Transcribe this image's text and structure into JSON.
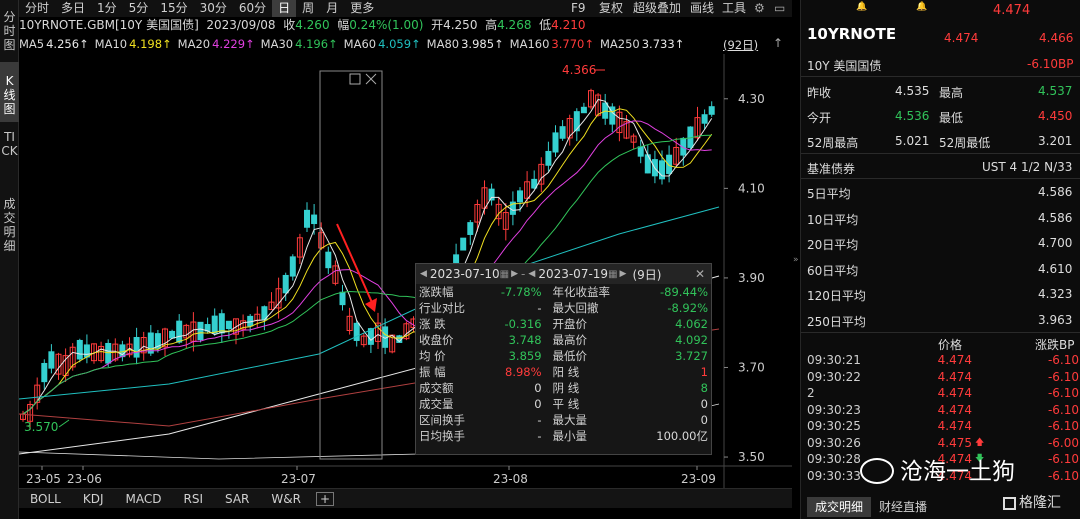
{
  "left_tabs": [
    "分时图",
    "K线图",
    "TICK",
    "成交明细"
  ],
  "toolbar": {
    "periods": [
      "分时",
      "多日",
      "1分",
      "5分",
      "15分",
      "30分",
      "60分",
      "日",
      "周",
      "月",
      "更多"
    ],
    "active": "日",
    "right_items": [
      "F9",
      "复权",
      "超级叠加",
      "画线",
      "工具"
    ]
  },
  "info": {
    "symbol": "10YRNOTE.GBM[10Y 美国国债]",
    "date": "2023/09/08",
    "close_label": "收",
    "close": "4.260",
    "change_label": "幅",
    "change": "0.24%(1.00)",
    "open_label": "开",
    "open": "4.250",
    "high_label": "高",
    "high": "4.268",
    "low_label": "低",
    "low": "4.210"
  },
  "ma": [
    {
      "label": "MA5",
      "value": "4.256↑",
      "color": "#e8e8e8"
    },
    {
      "label": "MA10",
      "value": "4.198↑",
      "color": "#f0e020"
    },
    {
      "label": "MA20",
      "value": "4.229↑",
      "color": "#e040e0"
    },
    {
      "label": "MA30",
      "value": "4.196↑",
      "color": "#31c35a"
    },
    {
      "label": "MA60",
      "value": "4.059↑",
      "color": "#20c0c0"
    },
    {
      "label": "MA80",
      "value": "3.985↑",
      "color": "#e8e8e8"
    },
    {
      "label": "MA160",
      "value": "3.770↑",
      "color": "#ff3b3b"
    },
    {
      "label": "MA250",
      "value": "3.733↑",
      "color": "#e8e8e8"
    }
  ],
  "period_badge": "(92日)",
  "chart_data": {
    "type": "candlestick",
    "y_ticks": [
      "4.30",
      "4.10",
      "3.90",
      "3.70",
      "3.50"
    ],
    "x_ticks": [
      "23-05",
      "23-06",
      "23-07",
      "23-08",
      "23-09"
    ],
    "ylim": [
      3.48,
      4.4
    ],
    "high_label": "4.366",
    "low_label": "3.570"
  },
  "popup": {
    "start_date": "2023-07-10",
    "end_date": "2023-07-19",
    "days": "(9日)",
    "rows": [
      {
        "l1": "涨跌幅",
        "v1": "-7.78%",
        "c1": "g",
        "l2": "年化收益率",
        "v2": "-89.44%",
        "c2": "g"
      },
      {
        "l1": "行业对比",
        "v1": "-",
        "c1": "w",
        "l2": "最大回撤",
        "v2": "-8.92%",
        "c2": "g"
      },
      {
        "l1": "涨  跌",
        "v1": "-0.316",
        "c1": "g",
        "l2": "开盘价",
        "v2": "4.062",
        "c2": "g"
      },
      {
        "l1": "收盘价",
        "v1": "3.748",
        "c1": "g",
        "l2": "最高价",
        "v2": "4.092",
        "c2": "g"
      },
      {
        "l1": "均  价",
        "v1": "3.859",
        "c1": "g",
        "l2": "最低价",
        "v2": "3.727",
        "c2": "g"
      },
      {
        "l1": "振  幅",
        "v1": "8.98%",
        "c1": "r",
        "l2": "阳  线",
        "v2": "1",
        "c2": "r"
      },
      {
        "l1": "成交额",
        "v1": "0",
        "c1": "w",
        "l2": "阴  线",
        "v2": "8",
        "c2": "g"
      },
      {
        "l1": "成交量",
        "v1": "0",
        "c1": "w",
        "l2": "平  线",
        "v2": "0",
        "c2": "w"
      },
      {
        "l1": "区间换手",
        "v1": "-",
        "c1": "w",
        "l2": "最大量",
        "v2": "0",
        "c2": "w"
      },
      {
        "l1": "日均换手",
        "v1": "-",
        "c1": "w",
        "l2": "最小量",
        "v2": "100.00亿",
        "c2": "w"
      }
    ]
  },
  "indicator_tabs": [
    "BOLL",
    "KDJ",
    "MACD",
    "RSI",
    "SAR",
    "W&R"
  ],
  "right": {
    "top_price": "4.474",
    "code": "10YRNOTE",
    "name": "10Y 美国国债",
    "price": "4.474",
    "price2": "4.466",
    "change_bp": "-6.10BP",
    "stats": [
      {
        "l1": "昨收",
        "v1": "4.535",
        "c1": "w",
        "l2": "最高",
        "v2": "4.537",
        "c2": "g"
      },
      {
        "l1": "今开",
        "v1": "4.536",
        "c1": "g",
        "l2": "最低",
        "v2": "4.450",
        "c2": "r"
      },
      {
        "l1": "52周最高",
        "v1": "5.021",
        "c1": "w",
        "l2": "52周最低",
        "v2": "3.201",
        "c2": "w"
      }
    ],
    "bench_label": "基准债券",
    "bench_value": "UST 4 1/2 N/33",
    "averages": [
      {
        "label": "5日平均",
        "value": "4.586"
      },
      {
        "label": "10日平均",
        "value": "4.586"
      },
      {
        "label": "20日平均",
        "value": "4.700"
      },
      {
        "label": "60日平均",
        "value": "4.610"
      },
      {
        "label": "120日平均",
        "value": "4.323"
      },
      {
        "label": "250日平均",
        "value": "3.963"
      }
    ],
    "trade_header_price": "价格",
    "trade_header_change": "涨跌BP",
    "trades": [
      {
        "time": "09:30:21",
        "price": "4.474",
        "arrow": "",
        "change": "-6.10"
      },
      {
        "time": "09:30:22",
        "price": "4.474",
        "arrow": "",
        "change": "-6.10"
      },
      {
        "time": "2",
        "price": "4.474",
        "arrow": "",
        "change": "-6.10"
      },
      {
        "time": "09:30:23",
        "price": "4.474",
        "arrow": "",
        "change": "-6.10"
      },
      {
        "time": "09:30:25",
        "price": "4.474",
        "arrow": "",
        "change": "-6.10"
      },
      {
        "time": "09:30:26",
        "price": "4.475",
        "arrow": "up",
        "change": "-6.00"
      },
      {
        "time": "09:30:28",
        "price": "4.474",
        "arrow": "down",
        "change": "-6.10"
      },
      {
        "time": "09:30:33",
        "price": "4.474",
        "arrow": "",
        "change": "-6.10"
      }
    ],
    "tabs": [
      "成交明细",
      "财经直播"
    ]
  },
  "watermark": "沧海一土狗",
  "logo": "格隆汇"
}
